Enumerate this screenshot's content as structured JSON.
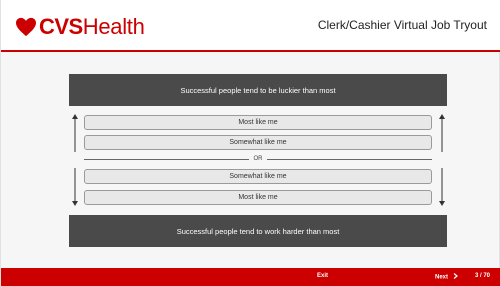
{
  "brand": {
    "bold": "CVS",
    "light": "Health",
    "color": "#cc0000"
  },
  "header": {
    "title": "Clerk/Cashier Virtual Job Tryout"
  },
  "question": {
    "top_statement": "Successful people tend to be luckier than most",
    "bottom_statement": "Successful people tend to work harder than most",
    "options_top": [
      "Most like me",
      "Somewhat like me"
    ],
    "divider": "OR",
    "options_bottom": [
      "Somewhat like me",
      "Most like me"
    ]
  },
  "footer": {
    "exit_label": "Exit",
    "next_label": "Next",
    "next_icon": "chevron-right-icon",
    "page_indicator": "3 / 70"
  }
}
